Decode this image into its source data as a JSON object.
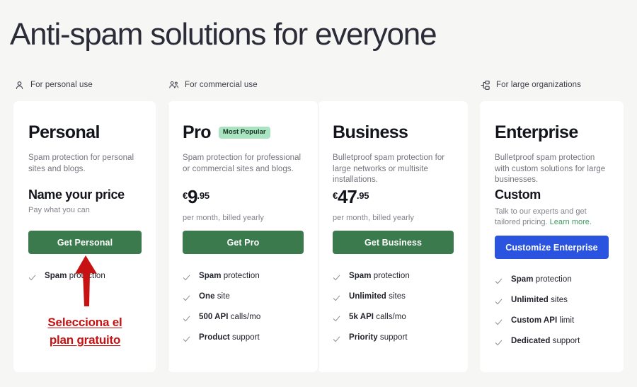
{
  "page": {
    "title": "Anti-spam solutions for everyone",
    "background_color": "#f6f6f5",
    "title_color": "#2b2c38"
  },
  "segments": [
    {
      "icon": "user-icon",
      "label": "For personal use"
    },
    {
      "icon": "users-icon",
      "label": "For commercial use"
    },
    {
      "icon": "org-chart-icon",
      "label": "For large organizations"
    }
  ],
  "colors": {
    "green_button": "#3a7a4d",
    "blue_button": "#2a54e0",
    "badge_background": "#a9e3c1",
    "link_green": "#3e9a62",
    "annotation_red": "#c61212"
  },
  "plans": [
    {
      "name": "Personal",
      "badge": null,
      "description": "Spam protection for personal sites and blogs.",
      "price_headline": "Name your price",
      "price_sub": "Pay what you can",
      "cta_label": "Get Personal",
      "cta_style": "green",
      "features": [
        {
          "bold": "Spam",
          "rest": " protection"
        }
      ]
    },
    {
      "name": "Pro",
      "badge": "Most Popular",
      "description": "Spam protection for professional or commercial sites and blogs.",
      "currency": "€",
      "amount": "9",
      "cents": ".95",
      "price_sub": "per month, billed yearly",
      "cta_label": "Get Pro",
      "cta_style": "green",
      "features": [
        {
          "bold": "Spam",
          "rest": " protection"
        },
        {
          "bold": "One",
          "rest": " site"
        },
        {
          "bold": "500 API",
          "rest": " calls/mo"
        },
        {
          "bold": "Product",
          "rest": " support"
        }
      ]
    },
    {
      "name": "Business",
      "badge": null,
      "description": "Bulletproof spam protection for large networks or multisite installations.",
      "currency": "€",
      "amount": "47",
      "cents": ".95",
      "price_sub": "per month, billed yearly",
      "cta_label": "Get Business",
      "cta_style": "green",
      "features": [
        {
          "bold": "Spam",
          "rest": " protection"
        },
        {
          "bold": "Unlimited",
          "rest": " sites"
        },
        {
          "bold": "5k API",
          "rest": " calls/mo"
        },
        {
          "bold": "Priority",
          "rest": " support"
        }
      ]
    },
    {
      "name": "Enterprise",
      "badge": null,
      "description": "Bulletproof spam protection with custom solutions for large businesses.",
      "price_headline": "Custom",
      "price_sub_pre": "Talk to our experts and get tailored pricing. ",
      "price_sub_link": "Learn more.",
      "cta_label": "Customize Enterprise",
      "cta_style": "blue",
      "features": [
        {
          "bold": "Spam",
          "rest": " protection"
        },
        {
          "bold": "Unlimited",
          "rest": " sites"
        },
        {
          "bold": "Custom API",
          "rest": " limit"
        },
        {
          "bold": "Dedicated",
          "rest": " support"
        }
      ]
    }
  ],
  "annotation": {
    "arrow": "up-arrow",
    "line1": "Selecciona el",
    "line2": "plan gratuito"
  }
}
